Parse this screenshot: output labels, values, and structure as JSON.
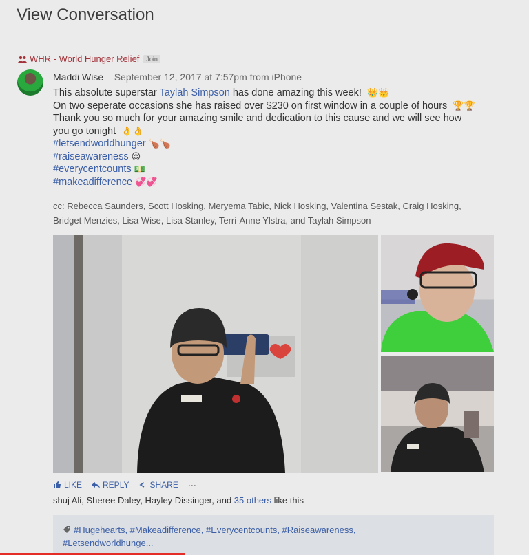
{
  "page": {
    "title": "View Conversation"
  },
  "group": {
    "name": "WHR - World Hunger Relief",
    "join_label": "Join"
  },
  "post": {
    "author": "Maddi Wise",
    "meta": " – September 12, 2017 at 7:57pm from iPhone",
    "line1_before": "This absolute superstar ",
    "line1_mention": "Taylah Simpson",
    "line1_after": " has done amazing this week! ",
    "line1_emoji": "👑👑",
    "line2": "On two seperate occasions she has raised over $230 on first window in a couple of hours ",
    "line2_emoji": "🏆🏆",
    "line3": "Thank you so much for your amazing smile and dedication to this cause and we will see how",
    "line4": "you go tonight ",
    "line4_emoji": "👌👌",
    "hashtags": [
      {
        "tag": "#letsendworldhunger",
        "emoji": "🍗🍗"
      },
      {
        "tag": "#raiseawareness",
        "emoji": "😌"
      },
      {
        "tag": "#everycentcounts",
        "emoji": "💵"
      },
      {
        "tag": "#makeadifference",
        "emoji": "💞💞"
      }
    ],
    "cc_line1": "cc: Rebecca Saunders, Scott Hosking, Meryema Tabic, Nick Hosking, Valentina Sestak, Craig Hosking,",
    "cc_line2": "Bridget Menzies, Lisa Wise, Lisa Stanley, Terri-Anne Ylstra, and Taylah Simpson"
  },
  "actions": {
    "like": "LIKE",
    "reply": "REPLY",
    "share": "SHARE",
    "more": "···"
  },
  "likes": {
    "names": "shuj Ali, Sheree Daley, Hayley Dissinger, and ",
    "others": "35 others",
    "suffix": " like this"
  },
  "topics": {
    "line1": "#Hugehearts, #Makeadifference, #Everycentcounts, #Raiseawareness,",
    "line2": "#Letsendworldhunge..."
  },
  "colors": {
    "link": "#3a5ea7",
    "group": "#a5333a",
    "progress": "#e52d27"
  },
  "video_progress": 0.35
}
